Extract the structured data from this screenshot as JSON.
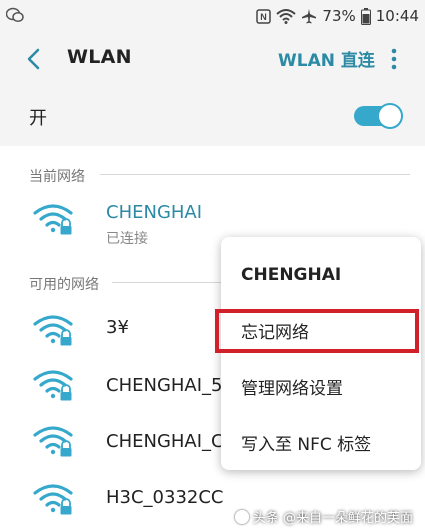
{
  "status_bar": {
    "battery_percent": "73%",
    "time": "10:44",
    "icons": [
      "wechat-icon",
      "nfc-icon",
      "wifi-icon",
      "airplane-icon",
      "battery-icon"
    ]
  },
  "header": {
    "title": "WLAN",
    "wifi_direct_label": "WLAN 直连",
    "icons": [
      "back-arrow-icon",
      "more-vert-icon"
    ]
  },
  "toggle": {
    "label": "开",
    "state": "on"
  },
  "sections": {
    "current": "当前网络",
    "available": "可用的网络"
  },
  "current_network": {
    "name": "CHENGHAI",
    "status": "已连接"
  },
  "available_networks": [
    {
      "name": "3¥"
    },
    {
      "name": "CHENGHAI_5"
    },
    {
      "name": "CHENGHAI_C"
    },
    {
      "name": "H3C_0332CC"
    }
  ],
  "context_menu": {
    "title": "CHENGHAI",
    "items": [
      {
        "label": "忘记网络",
        "highlighted": true
      },
      {
        "label": "管理网络设置"
      },
      {
        "label": "写入至 NFC 标签"
      }
    ]
  },
  "watermark": {
    "text": "头条 @来自一朵鲜花的芙面"
  },
  "colors": {
    "accent": "#2c8aa5",
    "toggle": "#35a8cc",
    "highlight": "#d0202a"
  }
}
